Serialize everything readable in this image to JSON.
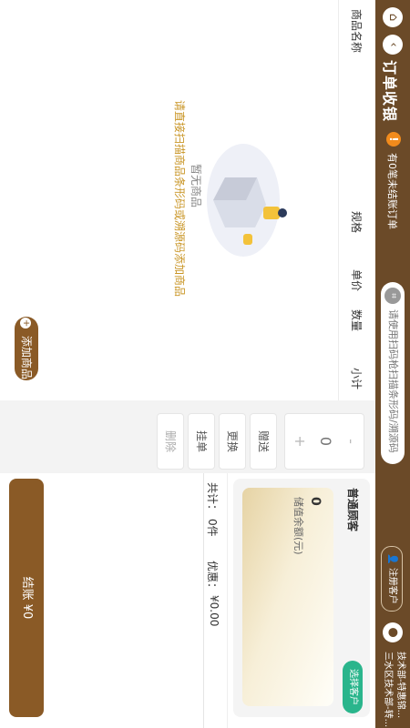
{
  "header": {
    "title": "订单收银",
    "warning": "有0笔未结账订单",
    "search_placeholder": "请使用扫码枪扫描条形码/溯源码",
    "register": "注册客户",
    "store_line1": "技术部-特惠锦...",
    "store_line2": "三水区技术部-转..."
  },
  "table": {
    "headers": [
      "商品名称",
      "规格",
      "单价",
      "数量",
      "小计"
    ]
  },
  "empty": {
    "line1": "暂无商品",
    "line2": "请直接扫描商品条形码或溯源码添加商品"
  },
  "buttons": {
    "add_product": "添加商品",
    "gift": "赠送",
    "change": "更换",
    "hold": "挂单",
    "delete": "删除",
    "checkout": "结账 ¥0"
  },
  "stepper": {
    "value": "0",
    "minus": "-",
    "plus": "+"
  },
  "customer": {
    "type": "普通顾客",
    "select": "选择客户",
    "stored_value": "0",
    "stored_label": "储值余额(元)"
  },
  "totals": {
    "count_label": "共计：",
    "count_value": "0件",
    "discount_label": "优惠：",
    "discount_value": "¥0.00"
  },
  "colors": {
    "brand": "#6b4a28",
    "accent": "#8a5a26",
    "green": "#2ab58c",
    "warn": "#f28b1c",
    "hint": "#c99525"
  }
}
